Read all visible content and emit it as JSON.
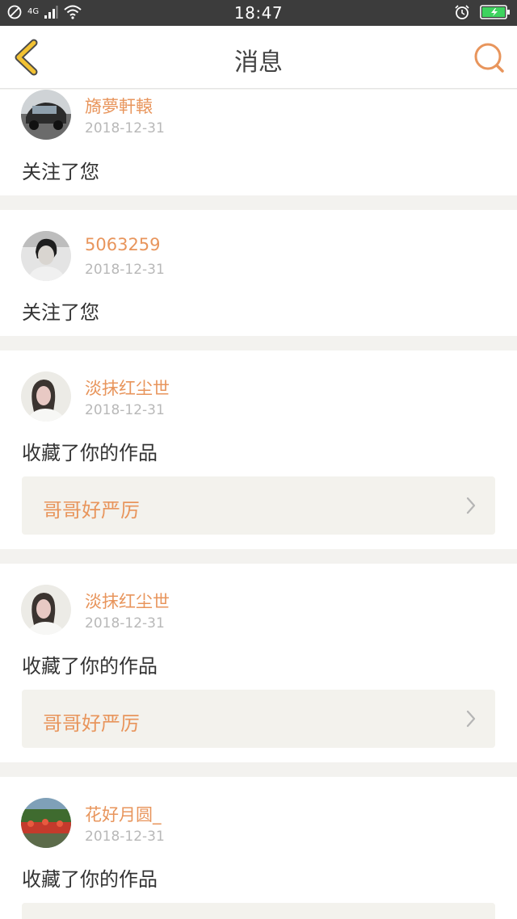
{
  "status_bar": {
    "time": "18:47",
    "network": "4G"
  },
  "header": {
    "title": "消息"
  },
  "colors": {
    "accent": "#e8955c",
    "back_icon": "#f2c233",
    "status_bar": "#3c3c3c",
    "battery": "#3dd35e"
  },
  "messages": [
    {
      "name": "旖夢軒轅",
      "date": "2018-12-31",
      "action": "关注了您"
    },
    {
      "name": "5063259",
      "date": "2018-12-31",
      "action": "关注了您"
    },
    {
      "name": "淡抹红尘世",
      "date": "2018-12-31",
      "action": "收藏了你的作品",
      "work": "哥哥好严厉"
    },
    {
      "name": "淡抹红尘世",
      "date": "2018-12-31",
      "action": "收藏了你的作品",
      "work": "哥哥好严厉"
    },
    {
      "name": "花好月圆_",
      "date": "2018-12-31",
      "action": "收藏了你的作品"
    }
  ]
}
